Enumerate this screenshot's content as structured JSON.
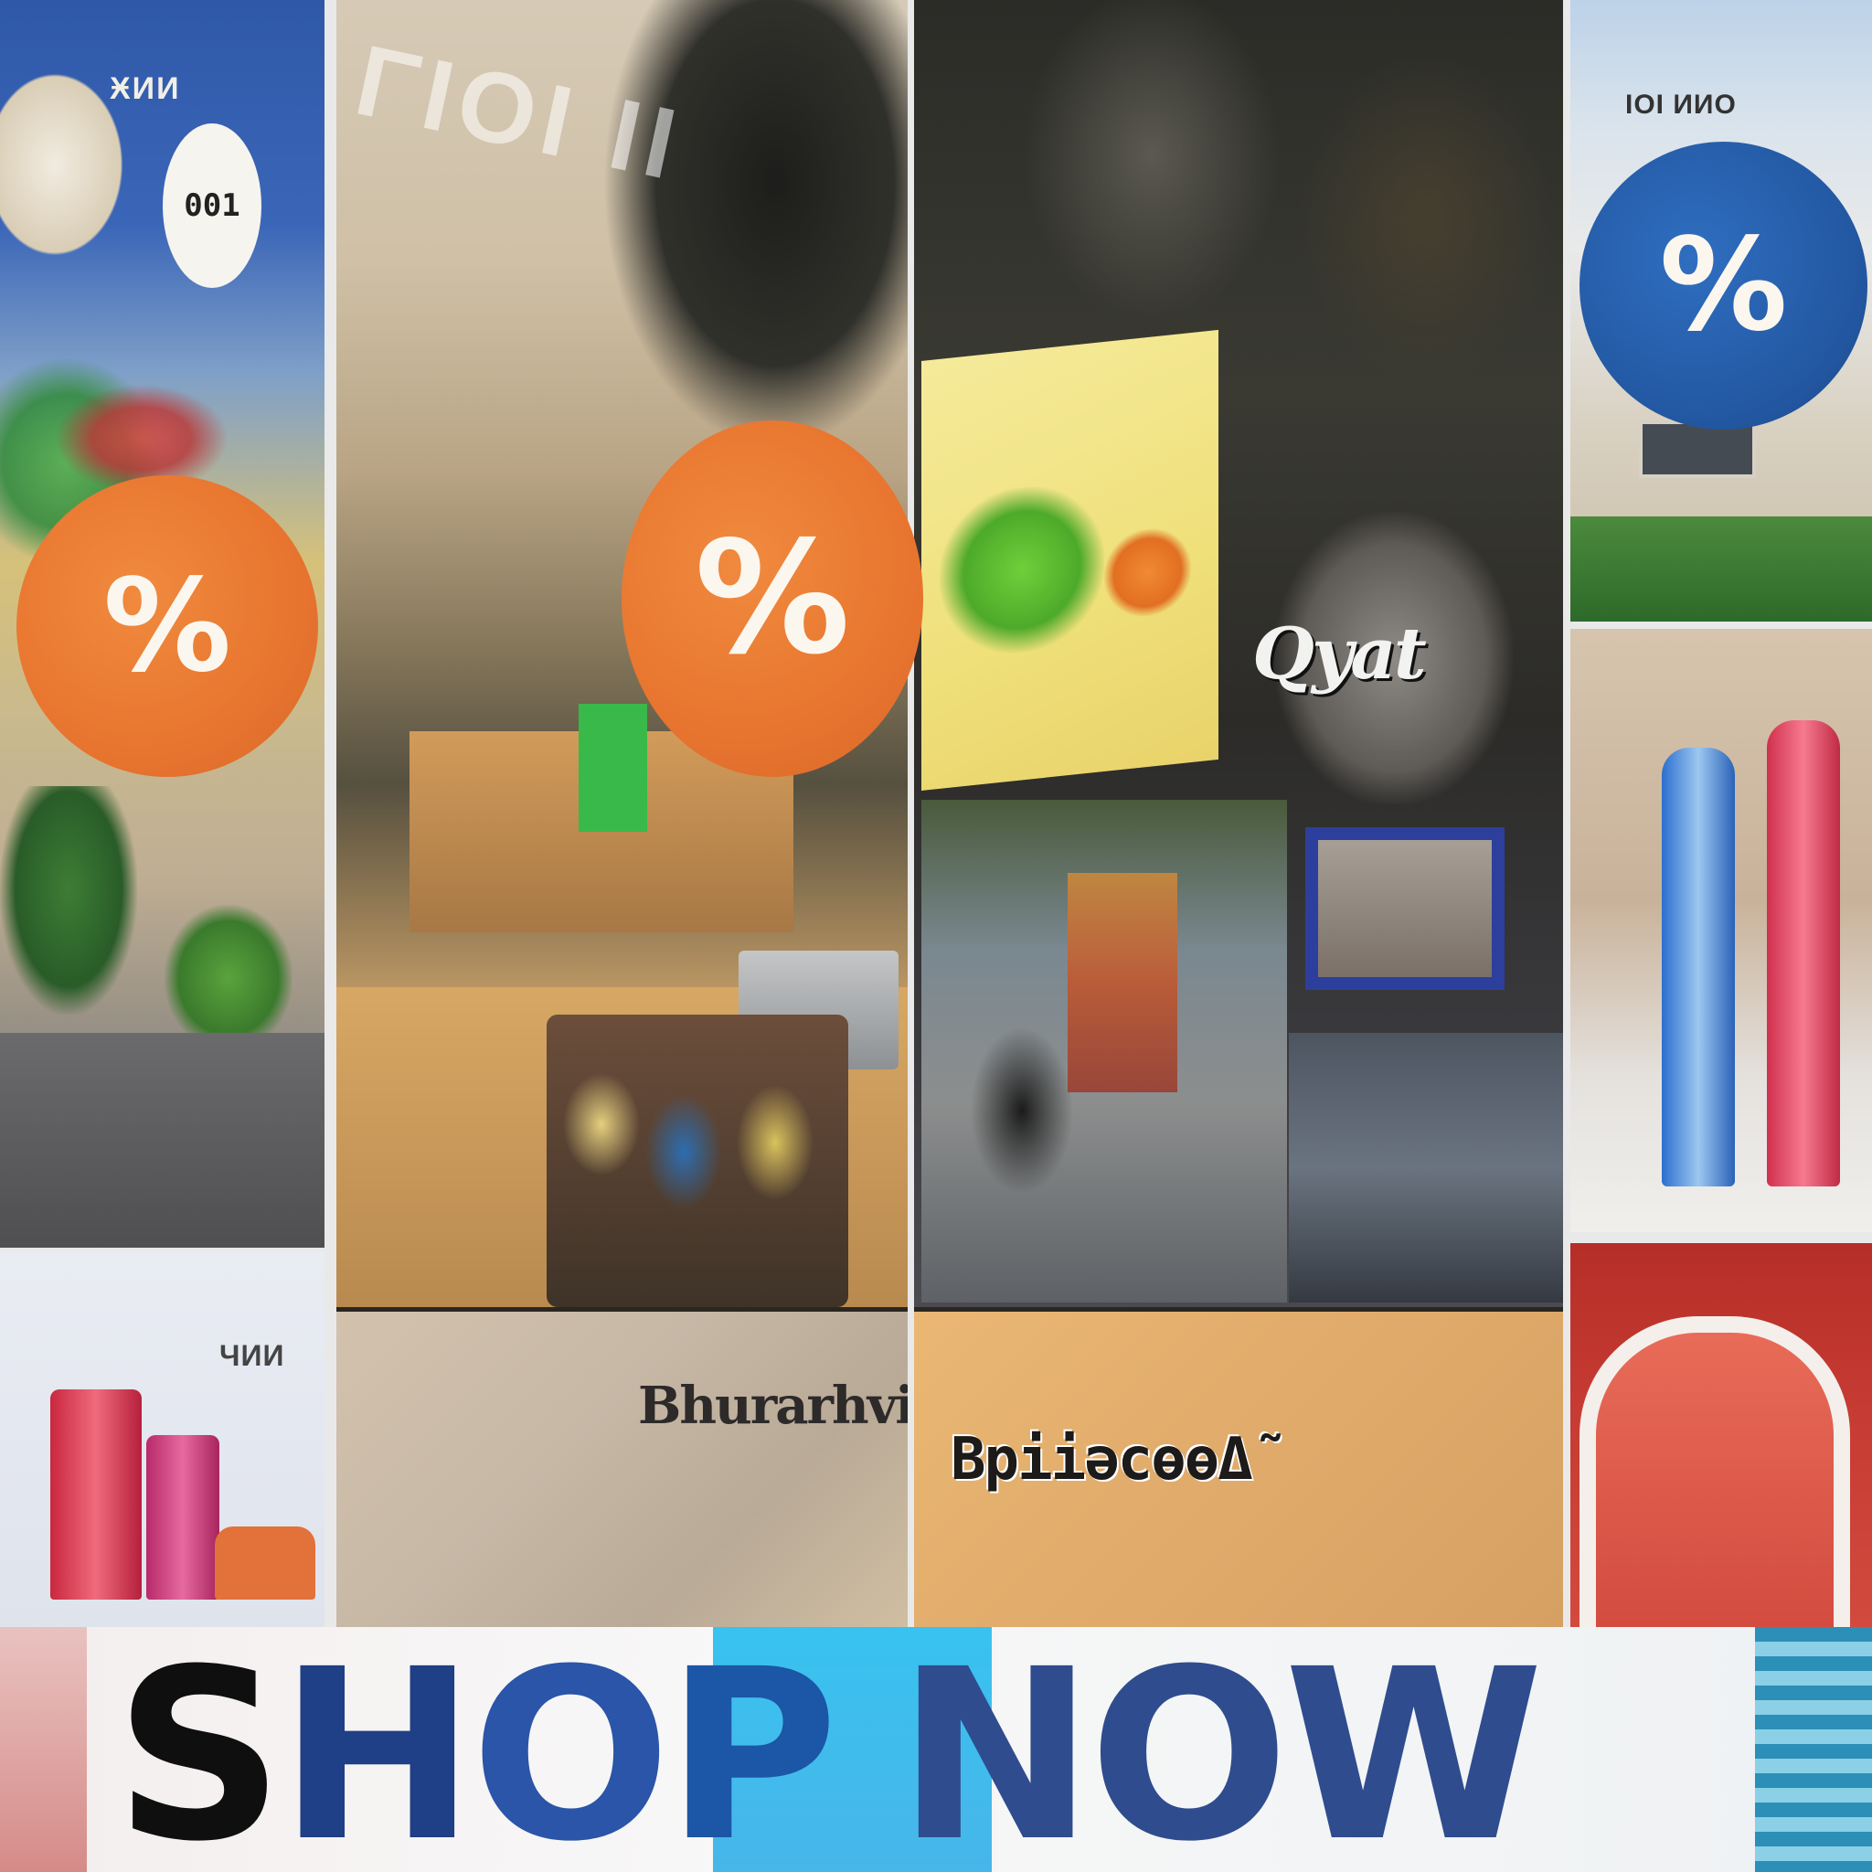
{
  "banner": {
    "word1": "SHOP",
    "word1_letters": [
      "S",
      "H",
      "O",
      "P"
    ],
    "word2": "NOW"
  },
  "badges": {
    "left_orange": "%",
    "center_orange": "%",
    "right_blue": "%"
  },
  "signs": {
    "left_top_small": "ӾИИ",
    "left_oval_tag": "001",
    "right_top_small": "ΙΟΙ ИИО",
    "left_bottom_small": "ЧИИ",
    "center_left_store": "Bhurarhvin",
    "center_right_store": "BpііәсөөΔ̃",
    "handwritten": "Qyat"
  },
  "colors": {
    "badge_orange": "#e8752f",
    "badge_blue": "#245aa5",
    "banner_cyan": "#39c2ef",
    "banner_navy": "#2f4c8e"
  }
}
